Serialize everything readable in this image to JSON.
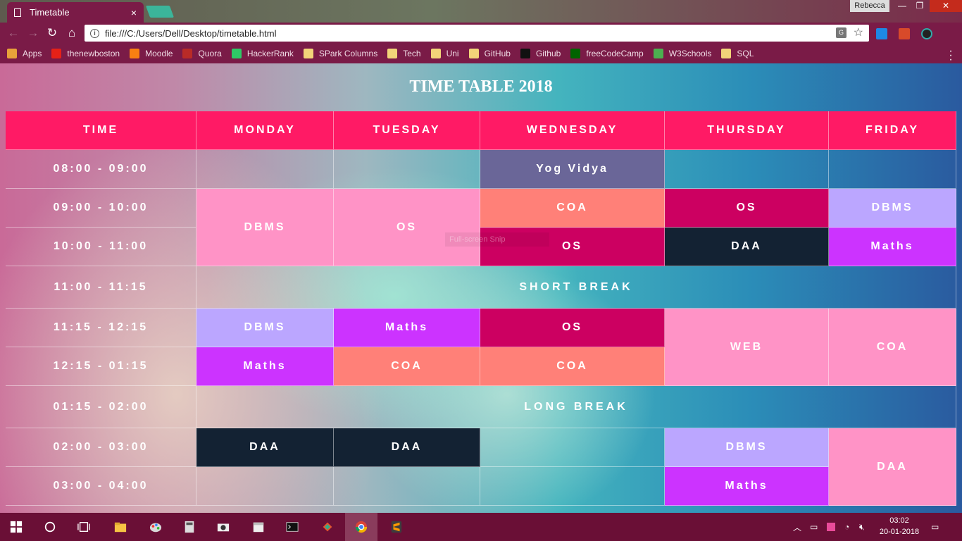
{
  "browser": {
    "tab_title": "Timetable",
    "user_name": "Rebecca",
    "url": "file:///C:/Users/Dell/Desktop/timetable.html",
    "bookmarks": [
      {
        "label": "Apps",
        "icon": "apps-grid-icon",
        "color": "#e8a23a"
      },
      {
        "label": "thenewboston",
        "icon": "youtube-icon",
        "color": "#e62117"
      },
      {
        "label": "Moodle",
        "icon": "moodle-icon",
        "color": "#f98012"
      },
      {
        "label": "Quora",
        "icon": "quora-icon",
        "color": "#b92b27"
      },
      {
        "label": "HackerRank",
        "icon": "hackerrank-icon",
        "color": "#2ec866"
      },
      {
        "label": "SPark Columns",
        "icon": "folder-icon",
        "color": "#f2d479"
      },
      {
        "label": "Tech",
        "icon": "folder-icon",
        "color": "#f2d479"
      },
      {
        "label": "Uni",
        "icon": "folder-icon",
        "color": "#f2d479"
      },
      {
        "label": "GitHub",
        "icon": "folder-icon",
        "color": "#f2d479"
      },
      {
        "label": "Github",
        "icon": "github-icon",
        "color": "#111111"
      },
      {
        "label": "freeCodeCamp",
        "icon": "freecodecamp-icon",
        "color": "#006400"
      },
      {
        "label": "W3Schools",
        "icon": "w3schools-icon",
        "color": "#4caf50"
      },
      {
        "label": "SQL",
        "icon": "folder-icon",
        "color": "#f2d479"
      }
    ]
  },
  "page": {
    "title": "TIME TABLE 2018",
    "faint_tooltip": "Full-screen Snip"
  },
  "timetable": {
    "headers": [
      "TIME",
      "MONDAY",
      "TUESDAY",
      "WEDNESDAY",
      "THURSDAY",
      "FRIDAY"
    ],
    "times": [
      "08:00 - 09:00",
      "09:00 - 10:00",
      "10:00 - 11:00",
      "11:00 - 11:15",
      "11:15 - 12:15",
      "12:15 - 01:15",
      "01:15 - 02:00",
      "02:00 - 03:00",
      "03:00 - 04:00"
    ],
    "short_break": "SHORT BREAK",
    "long_break": "LONG BREAK",
    "sessions": {
      "wed_0800": "Yog Vidya",
      "mon_0900": "DBMS",
      "tue_0900": "OS",
      "wed_0900": "COA",
      "thu_0900": "OS",
      "fri_0900": "DBMS",
      "wed_1000": "OS",
      "thu_1000": "DAA",
      "fri_1000": "Maths",
      "mon_1115": "DBMS",
      "tue_1115": "Maths",
      "wed_1115": "OS",
      "thu_1115": "WEB",
      "fri_1115": "COA",
      "mon_1215": "Maths",
      "tue_1215": "COA",
      "wed_1215": "COA",
      "mon_0200": "DAA",
      "tue_0200": "DAA",
      "thu_0200": "DBMS",
      "fri_0200": "DAA",
      "thu_0300": "Maths"
    },
    "colors": {
      "header": "#ff1a65",
      "yog": "#6a6698",
      "pink": "#ff93c6",
      "salmon": "#ff8078",
      "crimson": "#cc0061",
      "lavender": "#bba6ff",
      "purple": "#cc33ff",
      "navy": "#132233"
    }
  },
  "taskbar": {
    "time": "03:02",
    "date": "20-01-2018"
  }
}
